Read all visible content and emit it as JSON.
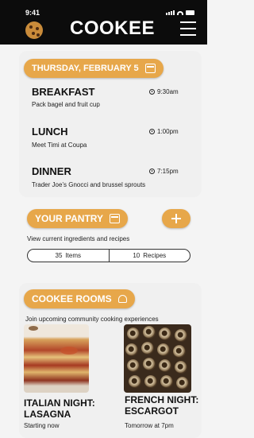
{
  "status_bar": {
    "time": "9:41"
  },
  "header": {
    "app_name": "COOKEE"
  },
  "schedule": {
    "date_label": "THURSDAY, FEBRUARY 5",
    "meals": [
      {
        "title": "BREAKFAST",
        "description": "Pack bagel and fruit cup",
        "time": "9:30am"
      },
      {
        "title": "LUNCH",
        "description": "Meet Timi at Coupa",
        "time": "1:00pm"
      },
      {
        "title": "DINNER",
        "description": "Trader Joe’s Gnocci and brussel sprouts",
        "time": "7:15pm"
      }
    ]
  },
  "pantry": {
    "title": "YOUR PANTRY",
    "subtitle": "View current ingredients and recipes",
    "items_count": "35",
    "items_label": "Items",
    "recipes_count": "10",
    "recipes_label": "Recipes"
  },
  "rooms": {
    "title": "COOKEE ROOMS",
    "subtitle": "Join upcoming community cooking experiences",
    "events": [
      {
        "name_line1": "ITALIAN NIGHT:",
        "name_line2": "LASAGNA",
        "when": "Starting now"
      },
      {
        "name_line1": "FRENCH NIGHT:",
        "name_line2": "ESCARGOT",
        "when": "Tomorrow at 7pm"
      }
    ]
  },
  "colors": {
    "accent": "#e7a74a",
    "header_bg": "#0c0c0c",
    "card_bg": "#f0f0f0"
  }
}
